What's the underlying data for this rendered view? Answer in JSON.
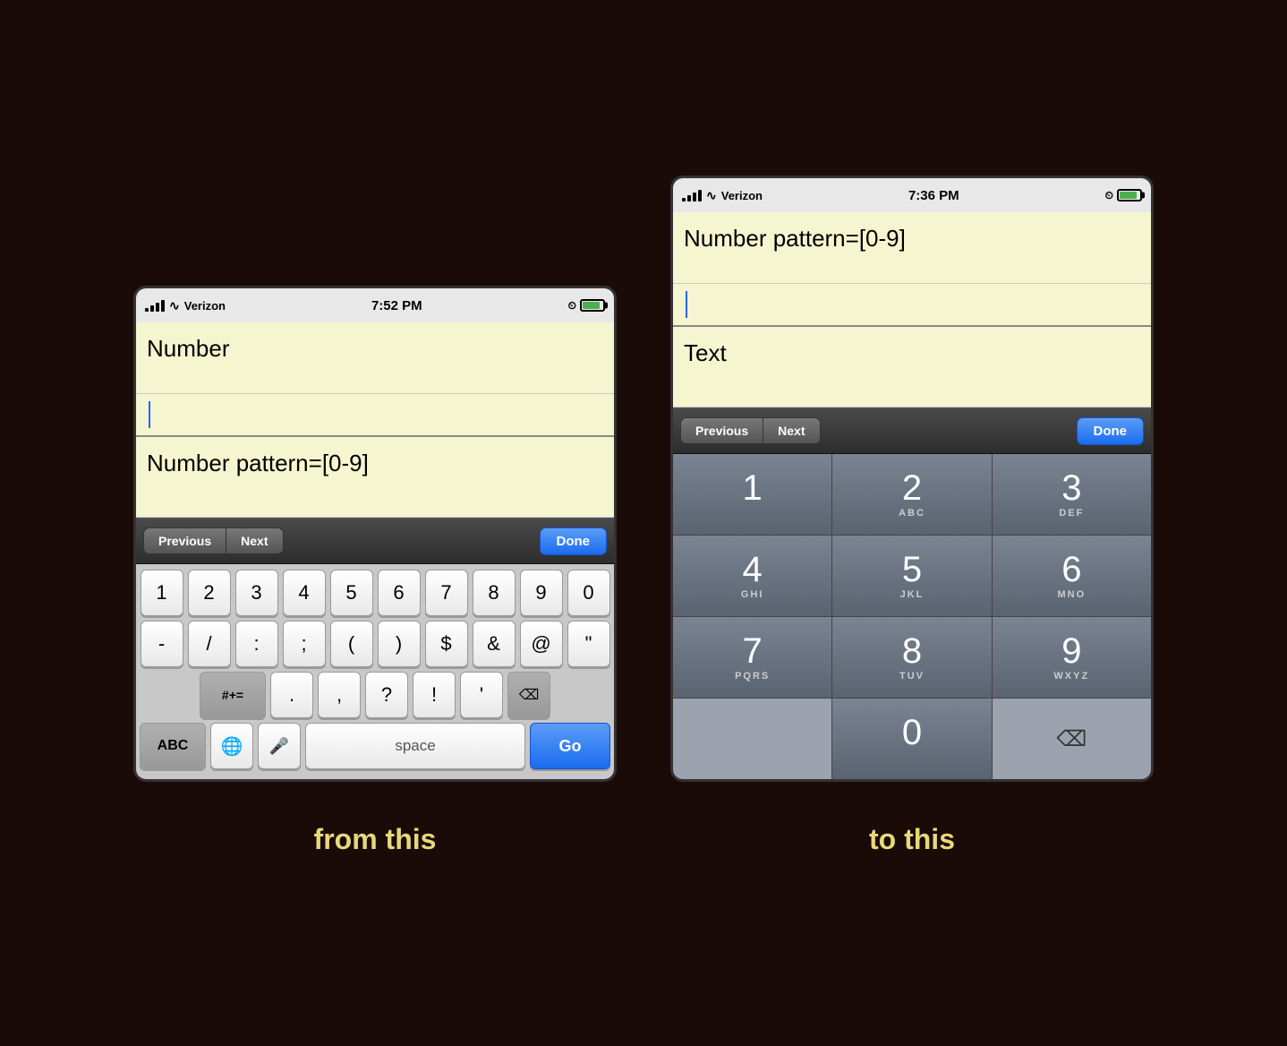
{
  "page": {
    "background": "#1a0a08",
    "caption_left": "from this",
    "caption_right": "to this"
  },
  "phone_left": {
    "status": {
      "carrier": "Verizon",
      "time": "7:52 PM"
    },
    "input_top": {
      "label": "Number"
    },
    "input_bottom": {
      "label": "Number pattern=[0-9]"
    },
    "toolbar": {
      "prev": "Previous",
      "next": "Next",
      "done": "Done"
    },
    "keyboard": {
      "row1": [
        "1",
        "2",
        "3",
        "4",
        "5",
        "6",
        "7",
        "8",
        "9",
        "0"
      ],
      "row2": [
        "-",
        "/",
        ":",
        ";",
        "(",
        ")",
        "$",
        "&",
        "@",
        "\""
      ],
      "row3_special": "#+=",
      "row3": [
        ".",
        "?",
        "!",
        "'"
      ],
      "bottom": {
        "abc": "ABC",
        "space": "space",
        "go": "Go"
      }
    }
  },
  "phone_right": {
    "status": {
      "carrier": "Verizon",
      "time": "7:36 PM"
    },
    "input_top": {
      "label": "Number pattern=[0-9]"
    },
    "input_bottom": {
      "label": "Text"
    },
    "toolbar": {
      "prev": "Previous",
      "next": "Next",
      "done": "Done"
    },
    "keypad": {
      "keys": [
        {
          "num": "1",
          "letters": ""
        },
        {
          "num": "2",
          "letters": "ABC"
        },
        {
          "num": "3",
          "letters": "DEF"
        },
        {
          "num": "4",
          "letters": "GHI"
        },
        {
          "num": "5",
          "letters": "JKL"
        },
        {
          "num": "6",
          "letters": "MNO"
        },
        {
          "num": "7",
          "letters": "PQRS"
        },
        {
          "num": "8",
          "letters": "TUV"
        },
        {
          "num": "9",
          "letters": "WXYZ"
        },
        {
          "num": "",
          "letters": ""
        },
        {
          "num": "0",
          "letters": ""
        },
        {
          "num": "⌫",
          "letters": ""
        }
      ]
    }
  }
}
